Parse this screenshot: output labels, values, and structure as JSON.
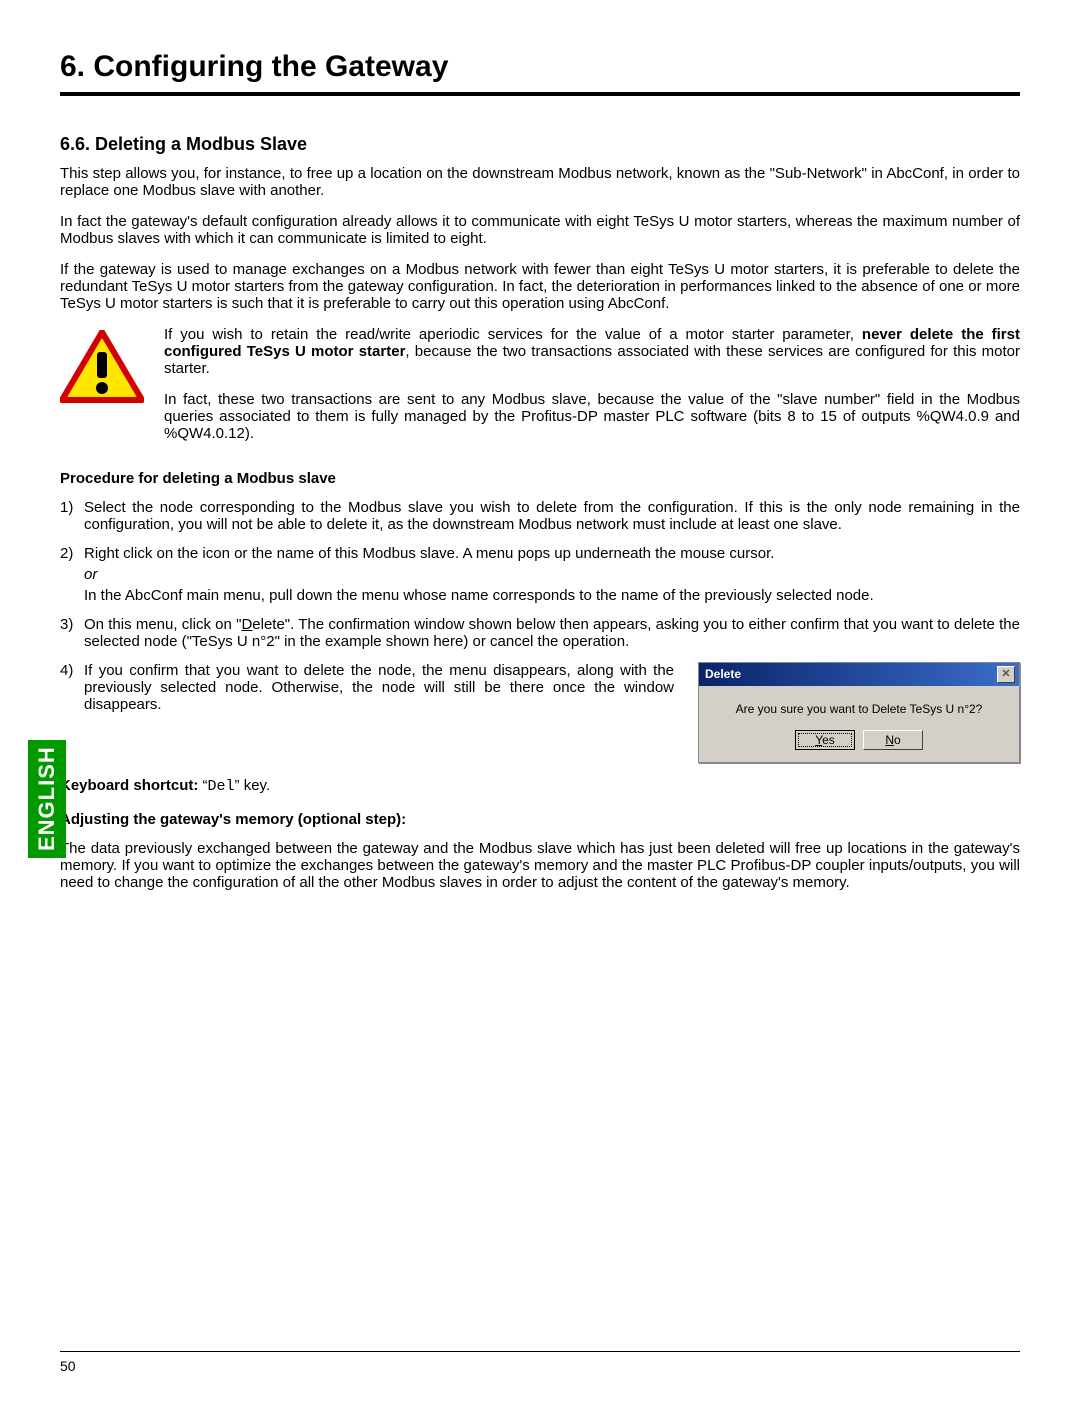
{
  "chapter_title": "6. Configuring the Gateway",
  "section_heading": "6.6. Deleting a Modbus Slave",
  "para1": "This step allows you, for instance, to free up a location on the downstream Modbus network, known as the \"Sub-Network\" in AbcConf, in order to replace one Modbus slave with another.",
  "para2": "In fact the gateway's default configuration already allows it to communicate with eight TeSys U motor starters, whereas the maximum number of Modbus slaves with which it can communicate is limited to eight.",
  "para3": "If the gateway is used to manage exchanges on a Modbus network with fewer than eight TeSys U motor starters, it is preferable to delete the redundant TeSys U motor starters from the gateway configuration. In fact, the deterioration in performances linked to the absence of one or more TeSys U motor starters is such that it is preferable to carry out this operation using AbcConf.",
  "icon_para1_a": "If you wish to retain the read/write aperiodic services for the value of a motor starter parameter, ",
  "icon_para1_bold": "never delete the first configured TeSys U motor starter",
  "icon_para1_b": ", because the two transactions associated with these services are configured for this motor starter.",
  "icon_para2": "In fact, these two transactions are sent to any Modbus slave, because the value of the \"slave number\" field in the Modbus queries associated to them is fully managed by the Profitus-DP master PLC software (bits 8 to 15 of outputs %QW4.0.9 and %QW4.0.12).",
  "procedure_heading": "Procedure for deleting a Modbus slave",
  "steps": {
    "n1": "1)",
    "s1": "Select the node corresponding to the Modbus slave you wish to delete from the configuration. If this is the only node remaining in the configuration, you will not be able to delete it, as the downstream Modbus network must include at least one slave.",
    "n2": "2)",
    "s2": "Right click on the icon or the name of this Modbus slave. A menu pops up underneath the mouse cursor.",
    "or": "or",
    "s2b": "In the AbcConf main menu, pull down the menu whose name corresponds to the name of the previously selected node.",
    "n3": "3)",
    "s3_a": "On this menu, click on \"",
    "s3_ul": "D",
    "s3_b": "elete\". The confirmation window shown below then appears, asking you to either confirm that you want to delete the selected node (\"TeSys U n°2\" in the example shown here) or cancel the operation.",
    "n4": "4)",
    "s4": "If you confirm that you want to delete the node, the menu disappears, along with the previously selected node. Otherwise, the node will still be there once the window disappears."
  },
  "dialog": {
    "title": "Delete",
    "message": "Are you sure you want to Delete TeSys U n°2?",
    "yes": "Yes",
    "no": "No"
  },
  "kb_label": "Keyboard shortcut:",
  "kb_key": "Del",
  "kb_suffix": "key.",
  "adjust_heading": "Adjusting the gateway's memory (optional step):",
  "adjust_para": "The data previously exchanged between the gateway and the Modbus slave which has just been deleted will free up locations in the gateway's memory. If you want to optimize the exchanges between the gateway's memory and the master PLC Profibus-DP coupler inputs/outputs, you will need to change the configuration of all the other Modbus slaves in order to adjust the content of the gateway's memory.",
  "lang_tab": "ENGLISH",
  "page_number": "50"
}
